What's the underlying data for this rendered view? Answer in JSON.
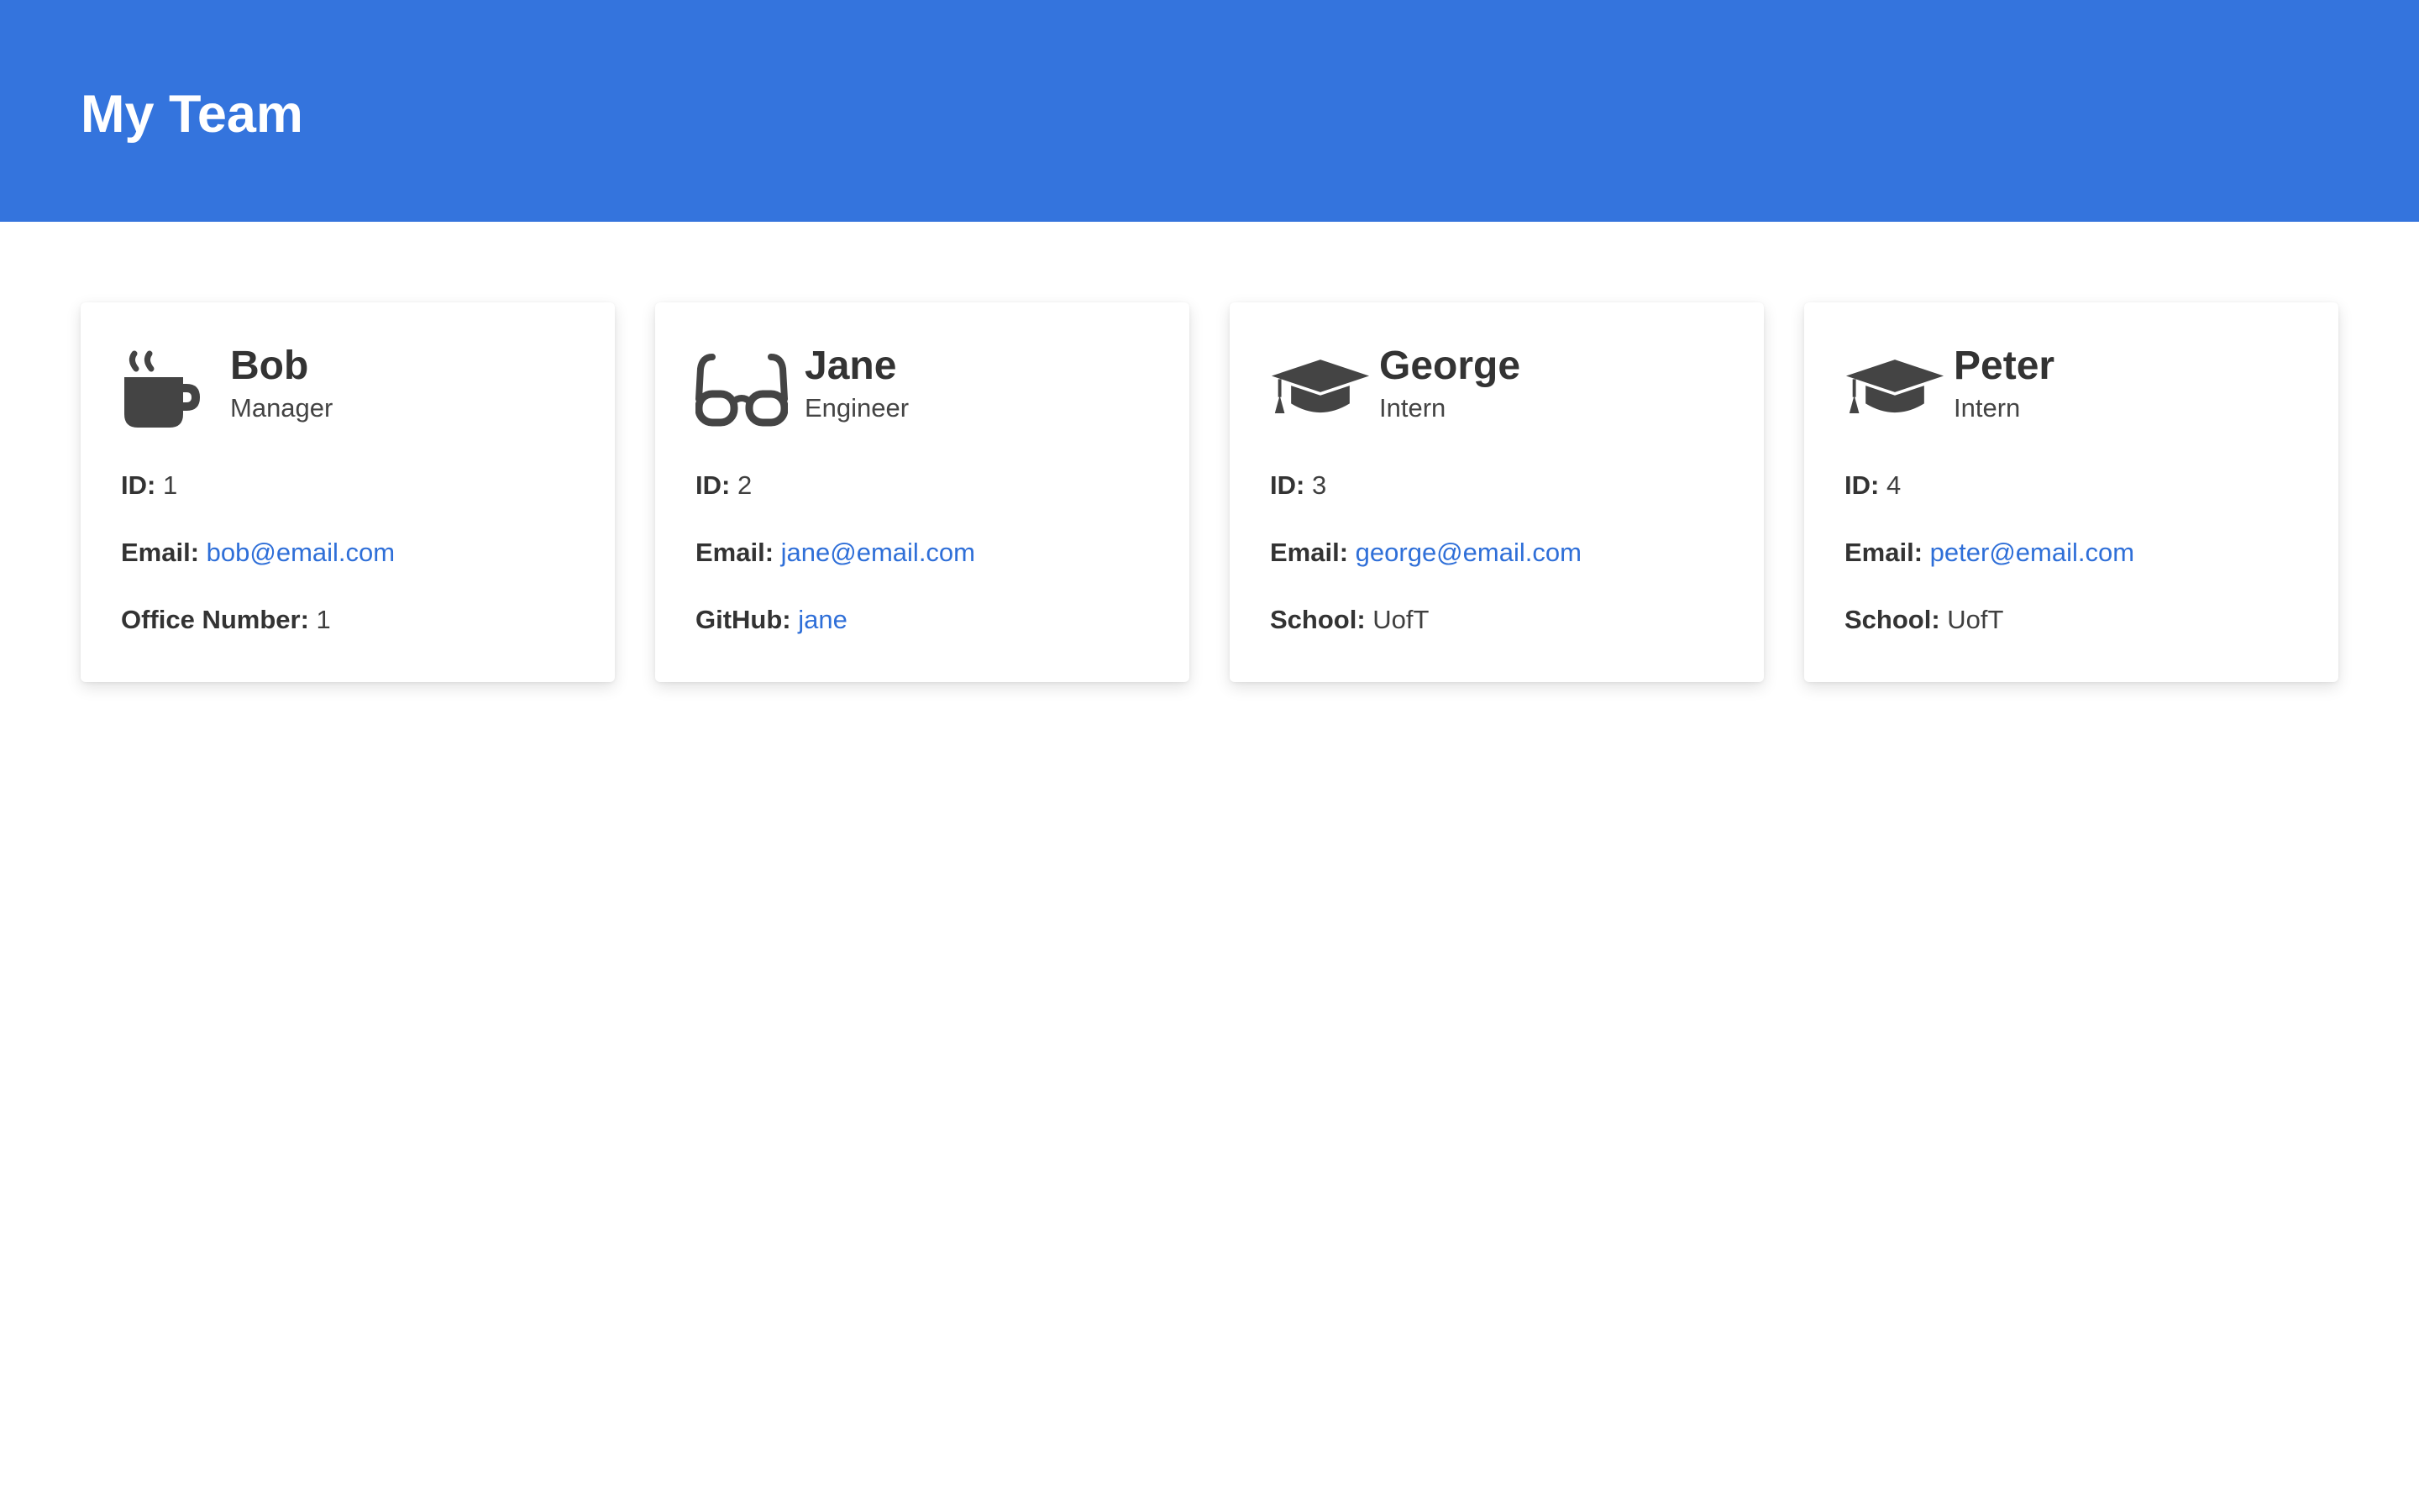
{
  "header": {
    "title": "My Team"
  },
  "icon_color": "#444444",
  "brand_color": "#3474dd",
  "link_color": "#2f6fd8",
  "team": [
    {
      "icon": "coffee-mug-icon",
      "name": "Bob",
      "role": "Manager",
      "id_label": "ID:",
      "id_value": "1",
      "email_label": "Email:",
      "email": "bob@email.com",
      "extra_label": "Office Number:",
      "extra_value": "1"
    },
    {
      "icon": "glasses-icon",
      "name": "Jane",
      "role": "Engineer",
      "id_label": "ID:",
      "id_value": "2",
      "email_label": "Email:",
      "email": "jane@email.com",
      "extra_label": "GitHub:",
      "extra_value": "jane"
    },
    {
      "icon": "graduation-cap-icon",
      "name": "George",
      "role": "Intern",
      "id_label": "ID:",
      "id_value": "3",
      "email_label": "Email:",
      "email": "george@email.com",
      "extra_label": "School:",
      "extra_value": "UofT"
    },
    {
      "icon": "graduation-cap-icon",
      "name": "Peter",
      "role": "Intern",
      "id_label": "ID:",
      "id_value": "4",
      "email_label": "Email:",
      "email": "peter@email.com",
      "extra_label": "School:",
      "extra_value": "UofT"
    }
  ]
}
